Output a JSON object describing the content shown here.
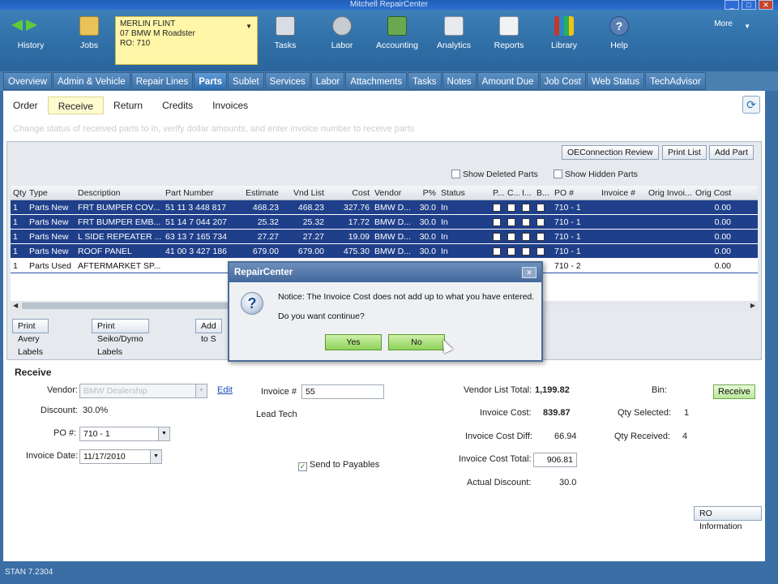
{
  "window": {
    "title": "Mitchell RepairCenter"
  },
  "toolbar": {
    "history": "History",
    "jobs": "Jobs",
    "ro": {
      "name": "MERLIN FLINT",
      "vehicle": "07 BMW M Roadster",
      "ro": "RO: 710"
    },
    "items": [
      "Tasks",
      "Labor",
      "Accounting",
      "Analytics",
      "Reports",
      "Library",
      "Help"
    ],
    "more": "More"
  },
  "tabs": [
    "Overview",
    "Admin & Vehicle",
    "Repair Lines",
    "Parts",
    "Sublet",
    "Services",
    "Labor",
    "Attachments",
    "Tasks",
    "Notes",
    "Amount Due",
    "Job Cost",
    "Web Status",
    "TechAdvisor"
  ],
  "active_tab": "Parts",
  "subtabs": [
    "Order",
    "Receive",
    "Return",
    "Credits",
    "Invoices"
  ],
  "active_subtab": "Receive",
  "hint": "Change status of received parts to in, verify dollar amounts, and enter invoice number to receive parts",
  "grid_buttons": {
    "oeconnection": "OEConnection Review",
    "print_list": "Print List",
    "add_part": "Add Part"
  },
  "options": {
    "show_deleted": "Show Deleted Parts",
    "show_hidden": "Show Hidden Parts"
  },
  "columns": [
    "Qty",
    "Type",
    "Description",
    "Part Number",
    "Estimate",
    "Vnd List",
    "Cost",
    "Vendor",
    "P%",
    "Status",
    "P...",
    "C...",
    "I...",
    "B...",
    "PO #",
    "Invoice #",
    "Orig Invoi...",
    "Orig Cost"
  ],
  "rows": [
    {
      "qty": "1",
      "type": "Parts New",
      "desc": "FRT BUMPER COV...",
      "part": "51 11 3 448 817",
      "est": "468.23",
      "vnd": "468.23",
      "cost": "327.76",
      "vendor": "BMW D...",
      "pct": "30.0",
      "status": "In",
      "po": "710 - 1",
      "origcost": "0.00",
      "selected": true
    },
    {
      "qty": "1",
      "type": "Parts New",
      "desc": "FRT BUMPER EMB...",
      "part": "51 14 7 044 207",
      "est": "25.32",
      "vnd": "25.32",
      "cost": "17.72",
      "vendor": "BMW D...",
      "pct": "30.0",
      "status": "In",
      "po": "710 - 1",
      "origcost": "0.00",
      "selected": true
    },
    {
      "qty": "1",
      "type": "Parts New",
      "desc": "L SIDE REPEATER ...",
      "part": "63 13 7 165 734",
      "est": "27.27",
      "vnd": "27.27",
      "cost": "19.09",
      "vendor": "BMW D...",
      "pct": "30.0",
      "status": "In",
      "po": "710 - 1",
      "origcost": "0.00",
      "selected": true
    },
    {
      "qty": "1",
      "type": "Parts New",
      "desc": "ROOF PANEL",
      "part": "41 00 3 427 186",
      "est": "679.00",
      "vnd": "679.00",
      "cost": "475.30",
      "vendor": "BMW D...",
      "pct": "30.0",
      "status": "In",
      "po": "710 - 1",
      "origcost": "0.00",
      "selected": true
    },
    {
      "qty": "1",
      "type": "Parts Used",
      "desc": "AFTERMARKET SP...",
      "part": "",
      "est": "",
      "vnd": "",
      "cost": "",
      "vendor": "",
      "pct": "",
      "status": "",
      "po": "710 - 2",
      "origcost": "0.00",
      "selected": false
    }
  ],
  "bottom_buttons": [
    "Print Avery Labels",
    "Print Seiko/Dymo Labels",
    "Add to S"
  ],
  "receive": {
    "heading": "Receive",
    "vendor_label": "Vendor:",
    "vendor_value": "BMW Dealership",
    "edit": "Edit",
    "discount_label": "Discount:",
    "discount_value": "30.0%",
    "po_label": "PO #:",
    "po_value": "710 - 1",
    "invdate_label": "Invoice Date:",
    "invdate_value": "11/17/2010",
    "invoice_label": "Invoice #",
    "invoice_value": "55",
    "lead_tech": "Lead Tech",
    "send_payables": "Send to Payables",
    "vlt_label": "Vendor List Total:",
    "vlt_value": "1,199.82",
    "ic_label": "Invoice Cost:",
    "ic_value": "839.87",
    "icd_label": "Invoice Cost Diff:",
    "icd_value": "66.94",
    "ict_label": "Invoice Cost Total:",
    "ict_value": "906.81",
    "ad_label": "Actual Discount:",
    "ad_value": "30.0",
    "bin_label": "Bin:",
    "receive_btn": "Receive",
    "qs_label": "Qty Selected:",
    "qs_value": "1",
    "qr_label": "Qty Received:",
    "qr_value": "4",
    "roinfo_btn": "RO Information"
  },
  "dialog": {
    "title": "RepairCenter",
    "line1": "Notice: The Invoice Cost does not add up to what you have entered.",
    "line2": "Do you want continue?",
    "yes": "Yes",
    "no": "No"
  },
  "footer": {
    "text": "STAN 7.2304"
  },
  "colors": {
    "accent": "#3a6ea5",
    "selection": "#1f3f8a",
    "ro_box": "#fff6a8",
    "receive_green": "#8ed25a"
  }
}
